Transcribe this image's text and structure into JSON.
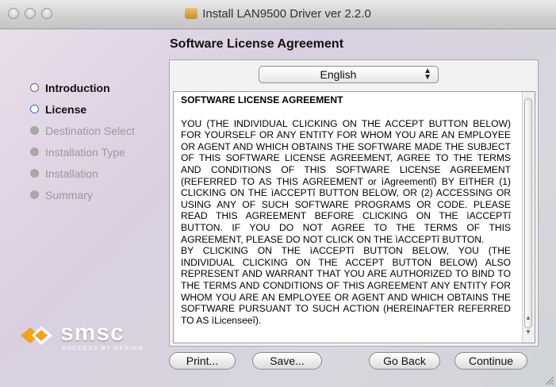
{
  "window": {
    "title": "Install LAN9500 Driver ver 2.2.0"
  },
  "header": {
    "heading": "Software License Agreement"
  },
  "steps": [
    {
      "label": "Introduction",
      "state": "done"
    },
    {
      "label": "License",
      "state": "current"
    },
    {
      "label": "Destination Select",
      "state": "todo"
    },
    {
      "label": "Installation Type",
      "state": "todo"
    },
    {
      "label": "Installation",
      "state": "todo"
    },
    {
      "label": "Summary",
      "state": "todo"
    }
  ],
  "language_select": {
    "selected": "English"
  },
  "license": {
    "title": "SOFTWARE LICENSE AGREEMENT",
    "paragraph1": "YOU (THE INDIVIDUAL CLICKING ON THE ACCEPT BUTTON BELOW) FOR YOURSELF OR ANY ENTITY FOR WHOM YOU ARE AN EMPLOYEE OR AGENT AND WHICH OBTAINS THE SOFTWARE MADE THE SUBJECT OF THIS SOFTWARE LICENSE AGREEMENT, AGREE TO THE TERMS AND CONDITIONS OF THIS SOFTWARE LICENSE AGREEMENT (REFERRED TO AS THIS AGREEMENT or ìAgreementî) BY EITHER (1) CLICKING ON THE ìACCEPTî BUTTON BELOW, OR (2) ACCESSING OR USING ANY OF SUCH SOFTWARE PROGRAMS OR CODE. PLEASE READ THIS AGREEMENT BEFORE CLICKING ON THE ìACCEPTî BUTTON. IF YOU DO NOT AGREE TO THE TERMS OF THIS AGREEMENT, PLEASE DO NOT CLICK ON THE ìACCEPTî BUTTON.",
    "paragraph2": "BY CLICKING ON THE ìACCEPTî BUTTON BELOW, YOU (THE INDIVIDUAL CLICKING ON THE ACCEPT BUTTON BELOW) ALSO REPRESENT AND WARRANT THAT YOU ARE AUTHORIZED TO BIND TO THE TERMS AND CONDITIONS OF THIS AGREEMENT ANY ENTITY FOR WHOM YOU ARE AN EMPLOYEE OR AGENT AND WHICH OBTAINS THE SOFTWARE PURSUANT TO SUCH ACTION (HEREINAFTER REFERRED TO AS ìLicenseeî)."
  },
  "buttons": {
    "print": "Print...",
    "save": "Save...",
    "go_back": "Go Back",
    "continue": "Continue"
  },
  "logo": {
    "brand": "smsc",
    "tagline": "SUCCESS BY DESIGN"
  },
  "colors": {
    "current_step": "#3b6fd1",
    "logo_accent": "#f2a21c"
  }
}
